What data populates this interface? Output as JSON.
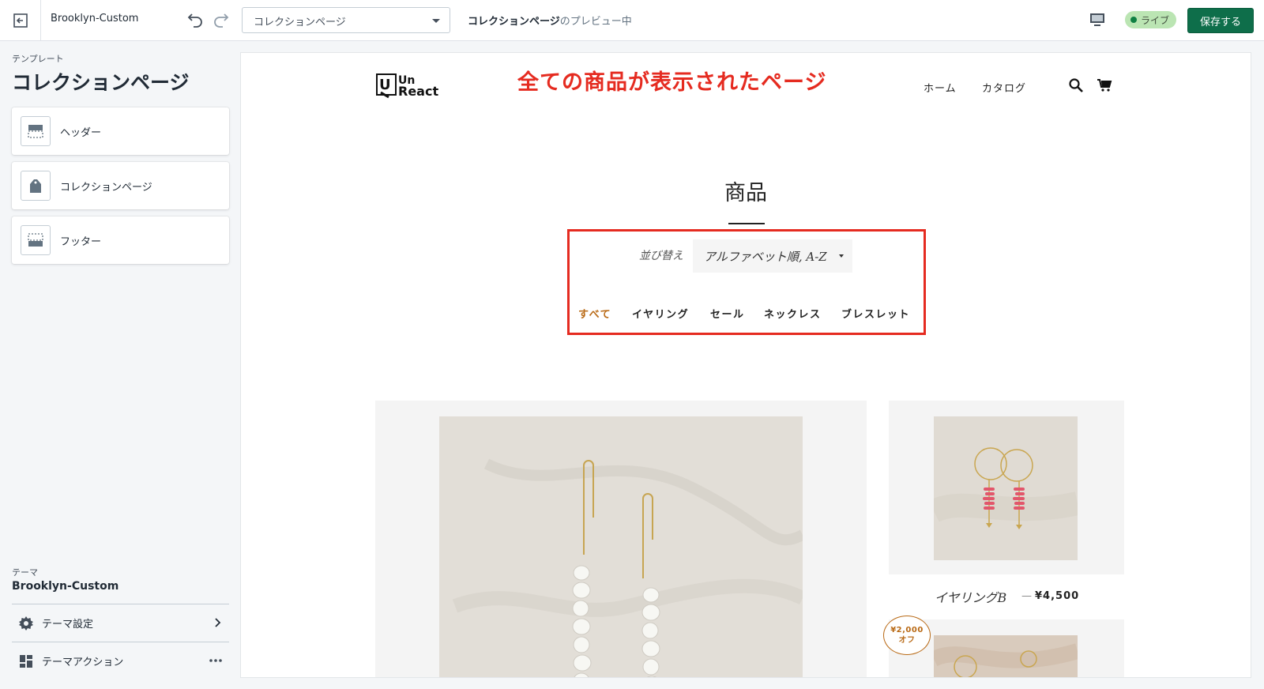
{
  "topbar": {
    "theme_name": "Brooklyn-Custom",
    "template_select": "コレクションページ",
    "preview_label_bold": "コレクションページ",
    "preview_label_rest": "のプレビュー中",
    "live_badge": "ライブ",
    "save_label": "保存する"
  },
  "sidebar": {
    "caption": "テンプレート",
    "title": "コレクションページ",
    "sections": [
      {
        "label": "ヘッダー",
        "icon": "header-section-icon"
      },
      {
        "label": "コレクションページ",
        "icon": "tag-icon"
      },
      {
        "label": "フッター",
        "icon": "footer-section-icon"
      }
    ],
    "theme_caption": "テーマ",
    "theme_name": "Brooklyn-Custom",
    "theme_settings": "テーマ設定",
    "theme_actions": "テーマアクション"
  },
  "store": {
    "logo_line1": "Un",
    "logo_line2": "React",
    "annotation": "全ての商品が表示されたページ",
    "nav": [
      "ホーム",
      "カタログ"
    ],
    "collection_title": "商品",
    "sort_label": "並び替え",
    "sort_value": "アルファベット順, A-Z",
    "tags": [
      "すべて",
      "イヤリング",
      "セール",
      "ネックレス",
      "ブレスレット"
    ],
    "active_tag": "すべて",
    "products": [
      {
        "title": "イヤリングB",
        "dash": "—",
        "price": "¥4,500"
      }
    ],
    "sale_badge_line1": "¥2,000",
    "sale_badge_line2": "オフ"
  },
  "colors": {
    "save_button": "#0e6e4a",
    "live_badge": "#bbe5b3",
    "annotation": "#e52b20",
    "active_tag": "#b96a16"
  }
}
